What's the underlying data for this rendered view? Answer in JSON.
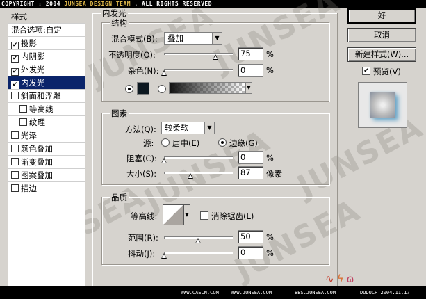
{
  "banner": {
    "copyright_pre": "COPYRIGHT : 2004 ",
    "copyright_hl": "JUNSEA DESIGN TEAM",
    "copyright_post": " . ALL RIGHTS RESERVED"
  },
  "watermark": "JUNSEA",
  "styles_list": {
    "header": "样式",
    "blend_options": "混合选项:自定",
    "items": [
      {
        "label": "投影",
        "checked": true
      },
      {
        "label": "内阴影",
        "checked": true
      },
      {
        "label": "外发光",
        "checked": true
      },
      {
        "label": "内发光",
        "checked": true,
        "selected": true
      },
      {
        "label": "斜面和浮雕",
        "checked": false
      },
      {
        "label": "等高线",
        "checked": false,
        "sub": true
      },
      {
        "label": "纹理",
        "checked": false,
        "sub": true
      },
      {
        "label": "光泽",
        "checked": false
      },
      {
        "label": "颜色叠加",
        "checked": false
      },
      {
        "label": "渐变叠加",
        "checked": false
      },
      {
        "label": "图案叠加",
        "checked": false
      },
      {
        "label": "描边",
        "checked": false
      }
    ]
  },
  "panel": {
    "title": "内发光",
    "structure": {
      "title": "结构",
      "blend_mode_label": "混合模式(B):",
      "blend_mode_value": "叠加",
      "opacity_label": "不透明度(O):",
      "opacity_value": "75",
      "noise_label": "杂色(N):",
      "noise_value": "0",
      "percent": "%"
    },
    "elements": {
      "title": "图素",
      "technique_label": "方法(Q):",
      "technique_value": "较柔软",
      "source_label": "源:",
      "source_center": "居中(E)",
      "source_edge": "边缘(G)",
      "choke_label": "阻塞(C):",
      "choke_value": "0",
      "size_label": "大小(S):",
      "size_value": "87",
      "px_unit": "像素",
      "percent": "%"
    },
    "quality": {
      "title": "品质",
      "contour_label": "等高线:",
      "antialias_label": "消除锯齿(L)",
      "range_label": "范围(R):",
      "range_value": "50",
      "jitter_label": "抖动(J):",
      "jitter_value": "0",
      "percent": "%"
    }
  },
  "buttons": {
    "ok": "好",
    "cancel": "取消",
    "new_style": "新建样式(W)...",
    "preview": "预览(V)"
  },
  "footer": {
    "sites": [
      "WWW.CAECN.COM",
      "WWW.JUNSEA.COM",
      "BBS.JUNSEA.COM",
      "DUDUCH 2004.11.17"
    ]
  },
  "colors": {
    "selection": "#0a246a",
    "glow_color": "#0d1820",
    "preview_glow": "#6aa7c9"
  }
}
